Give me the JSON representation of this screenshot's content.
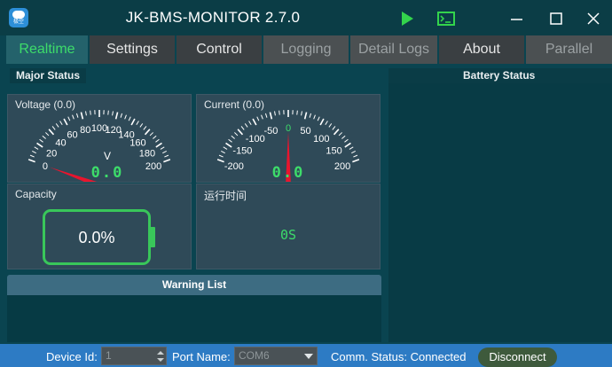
{
  "app": {
    "title": "JK-BMS-MONITOR 2.7.0",
    "logo_text": "极空"
  },
  "title_buttons": [
    "play-icon",
    "terminal-icon",
    "minimize-icon",
    "maximize-icon",
    "close-icon"
  ],
  "tabs": [
    {
      "label": "Realtime",
      "state": "active"
    },
    {
      "label": "Settings",
      "state": "normal"
    },
    {
      "label": "Control",
      "state": "normal"
    },
    {
      "label": "Logging",
      "state": "dim"
    },
    {
      "label": "Detail Logs",
      "state": "dim"
    },
    {
      "label": "About",
      "state": "normal"
    },
    {
      "label": "Parallel",
      "state": "dim"
    }
  ],
  "sections": {
    "major_status": "Major Status",
    "battery_status": "Battery Status"
  },
  "voltage": {
    "label": "Voltage (0.0)",
    "unit": "V",
    "readout": "0.0",
    "value": 0,
    "min": 0,
    "max": 200,
    "ticks": [
      "0",
      "20",
      "40",
      "60",
      "80",
      "100",
      "120",
      "140",
      "160",
      "180",
      "200"
    ]
  },
  "current": {
    "label": "Current (0.0)",
    "readout": "0.0",
    "value": 0,
    "min": -200,
    "max": 200,
    "ticks": [
      "-200",
      "-150",
      "-100",
      "-50",
      "0",
      "50",
      "100",
      "150",
      "200"
    ]
  },
  "capacity": {
    "label": "Capacity",
    "value_text": "0.0%",
    "percent": 0
  },
  "runtime": {
    "label": "运行时间",
    "value": "0S"
  },
  "warning_list": {
    "title": "Warning List",
    "items": []
  },
  "statusbar": {
    "device_id_label": "Device Id:",
    "device_id_value": "1",
    "port_label": "Port Name:",
    "port_value": "COM6",
    "comm_status": "Comm. Status: Connected",
    "disconnect_label": "Disconnect"
  },
  "colors": {
    "background": "#0a4450",
    "accent_green": "#3ddc6a",
    "needle_red": "#e8152e",
    "statusbar_blue": "#2d7bc4"
  }
}
